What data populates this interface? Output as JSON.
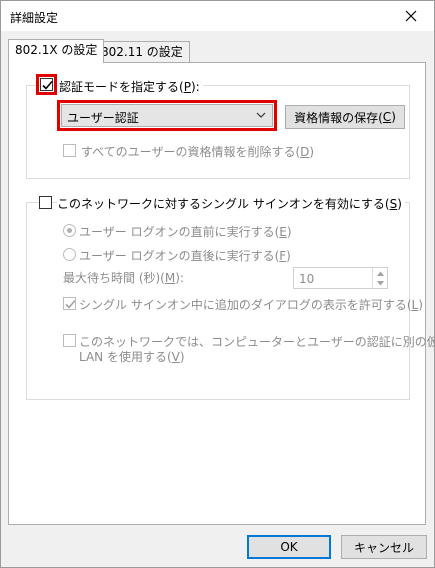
{
  "window": {
    "title": "詳細設定",
    "icons": {
      "close": "close-icon"
    }
  },
  "tabs": [
    {
      "label": "802.1X の設定",
      "active": true
    },
    {
      "label": "802.11 の設定",
      "active": false
    }
  ],
  "auth_group": {
    "specify_mode": {
      "label_pre": "認証モードを指定する(",
      "key": "P",
      "label_post": "):",
      "checked": true
    },
    "mode_select": {
      "value": "ユーザー認証"
    },
    "save_credentials_button": {
      "label_pre": "資格情報の保存(",
      "key": "C",
      "label_post": ")"
    },
    "delete_credentials": {
      "label_pre": "すべてのユーザーの資格情報を削除する(",
      "key": "D",
      "label_post": ")",
      "checked": false
    }
  },
  "sso_group": {
    "enable_sso": {
      "label_pre": "このネットワークに対するシングル サインオンを有効にする(",
      "key": "S",
      "label_post": ")",
      "checked": false
    },
    "before_logon": {
      "label_pre": "ユーザー ログオンの直前に実行する(",
      "key": "E",
      "label_post": ")",
      "selected": true
    },
    "after_logon": {
      "label_pre": "ユーザー ログオンの直後に実行する(",
      "key": "F",
      "label_post": ")",
      "selected": false
    },
    "max_delay": {
      "label_pre": "最大待ち時間 (秒)(",
      "key": "M",
      "label_post": "):",
      "value": "10"
    },
    "allow_dialogs": {
      "label_pre": "シングル サインオン中に追加のダイアログの表示を許可する(",
      "key": "L",
      "label_post": ")",
      "checked": true
    },
    "separate_vlan": {
      "line1": "このネットワークでは、コンピューターとユーザーの認証に別の仮想",
      "line2_pre": "LAN を使用する(",
      "key": "V",
      "label_post": ")",
      "checked": false
    }
  },
  "footer": {
    "ok_label": "OK",
    "cancel_label": "キャンセル"
  },
  "colors": {
    "highlight": "#e00000",
    "accent": "#0078d7"
  }
}
